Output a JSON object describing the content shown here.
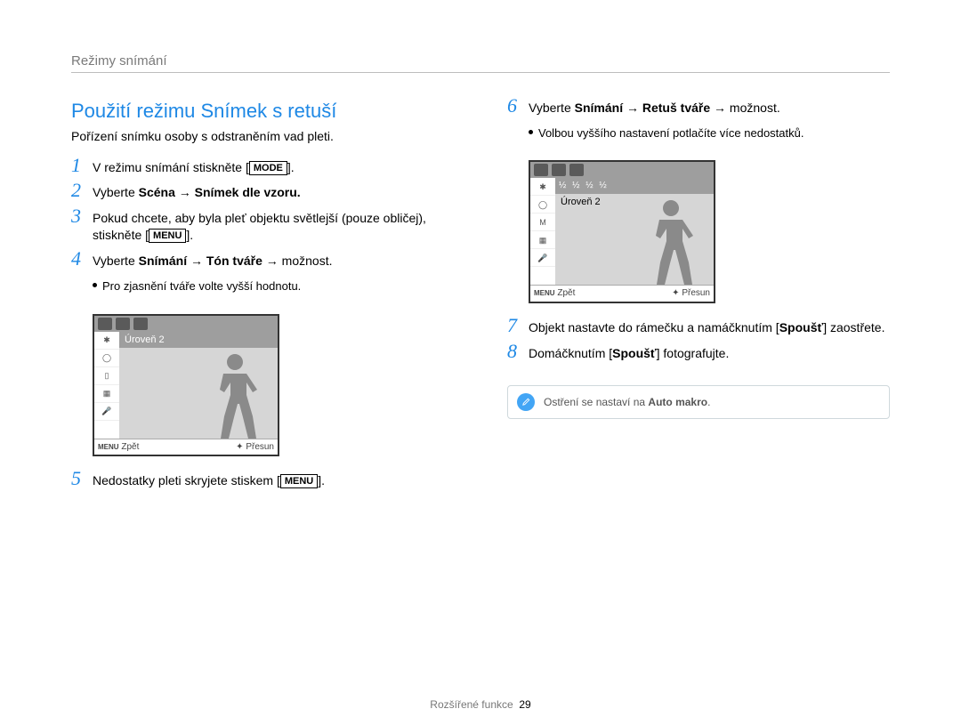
{
  "header": "Režimy snímání",
  "left": {
    "title": "Použití režimu Snímek s retuší",
    "sub": "Pořízení snímku osoby s odstraněním vad pleti.",
    "s1": {
      "num": "1",
      "a": "V režimu snímání stiskněte [",
      "key": "MODE",
      "b": "]."
    },
    "s2": {
      "num": "2",
      "a": "Vyberte ",
      "b": "Scéna",
      "c": " → ",
      "d": "Snímek dle vzoru."
    },
    "s3": {
      "num": "3",
      "a": "Pokud chcete, aby byla pleť objektu světlejší (pouze obličej), stiskněte [",
      "key": "MENU",
      "b": "]."
    },
    "s4": {
      "num": "4",
      "a": "Vyberte ",
      "b": "Snímání",
      "c": " → ",
      "d": "Tón tváře",
      "e": " → možnost.",
      "bul": "Pro zjasnění tváře volte vyšší hodnotu."
    },
    "cam": {
      "level": "Úroveň 2",
      "footL": "Zpět",
      "footLkey": "MENU",
      "footR": "Přesun"
    },
    "s5": {
      "num": "5",
      "a": "Nedostatky pleti skryjete stiskem [",
      "key": "MENU",
      "b": "]."
    }
  },
  "right": {
    "s6": {
      "num": "6",
      "a": "Vyberte ",
      "b": "Snímání",
      "c": " → ",
      "d": "Retuš tváře",
      "e": " → možnost.",
      "bul": "Volbou vyššího nastavení potlačíte více nedostatků."
    },
    "cam": {
      "level": "Úroveň 2",
      "fracbar": "½  ½  ½  ½",
      "footL": "Zpět",
      "footLkey": "MENU",
      "footR": "Přesun"
    },
    "s7": {
      "num": "7",
      "a": "Objekt nastavte do rámečku a namáčknutím [",
      "b": "Spoušť",
      "c": "] zaostřete."
    },
    "s8": {
      "num": "8",
      "a": "Domáčknutím [",
      "b": "Spoušť",
      "c": "] fotografujte."
    },
    "note": {
      "a": "Ostření se nastaví na ",
      "b": "Auto makro",
      "c": "."
    }
  },
  "footer": {
    "section": "Rozšířené funkce",
    "page": "29"
  }
}
